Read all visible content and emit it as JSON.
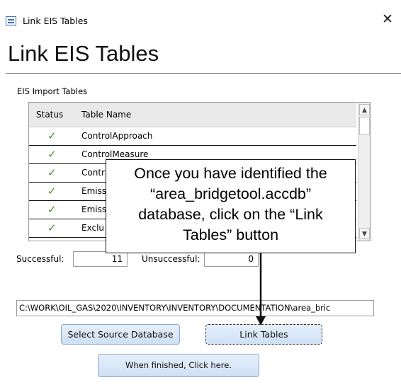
{
  "window": {
    "title": "Link EIS Tables",
    "close_glyph": "✕",
    "app_icon": "form-icon"
  },
  "form": {
    "heading": "Link EIS Tables",
    "subform_label": "EIS Import Tables"
  },
  "table": {
    "columns": [
      "Status",
      "Table Name"
    ],
    "rows": [
      {
        "status_icon": "check-icon",
        "status_glyph": "✓",
        "name": "ControlApproach"
      },
      {
        "status_icon": "check-icon",
        "status_glyph": "✓",
        "name": "ControlMeasure"
      },
      {
        "status_icon": "check-icon",
        "status_glyph": "✓",
        "name": "Contr"
      },
      {
        "status_icon": "check-icon",
        "status_glyph": "✓",
        "name": "Emiss"
      },
      {
        "status_icon": "check-icon",
        "status_glyph": "✓",
        "name": "Emiss"
      },
      {
        "status_icon": "check-icon",
        "status_glyph": "✓",
        "name": "Exclu"
      }
    ],
    "scroll_up_glyph": "▲",
    "scroll_down_glyph": "▼"
  },
  "counts": {
    "successful_label": "Successful:",
    "successful_value": "11",
    "unsuccessful_label": "Unsuccessful:",
    "unsuccessful_value": "0"
  },
  "source": {
    "path": "C:\\WORK\\OIL_GAS\\2020\\INVENTORY\\INVENTORY\\DOCUMENTATION\\area_bric"
  },
  "buttons": {
    "select_source": "Select Source Database",
    "link_tables": "Link Tables",
    "finished": "When finished, Click here."
  },
  "callout": {
    "line1": "Once you have identified the",
    "line2": "“area_bridgetool.accdb”",
    "line3": "database, click on the “Link",
    "line4": "Tables” button"
  },
  "colors": {
    "check": "#4a8a1f",
    "button_fill": "#d6e5f6",
    "button_border": "#8aa9cf"
  }
}
